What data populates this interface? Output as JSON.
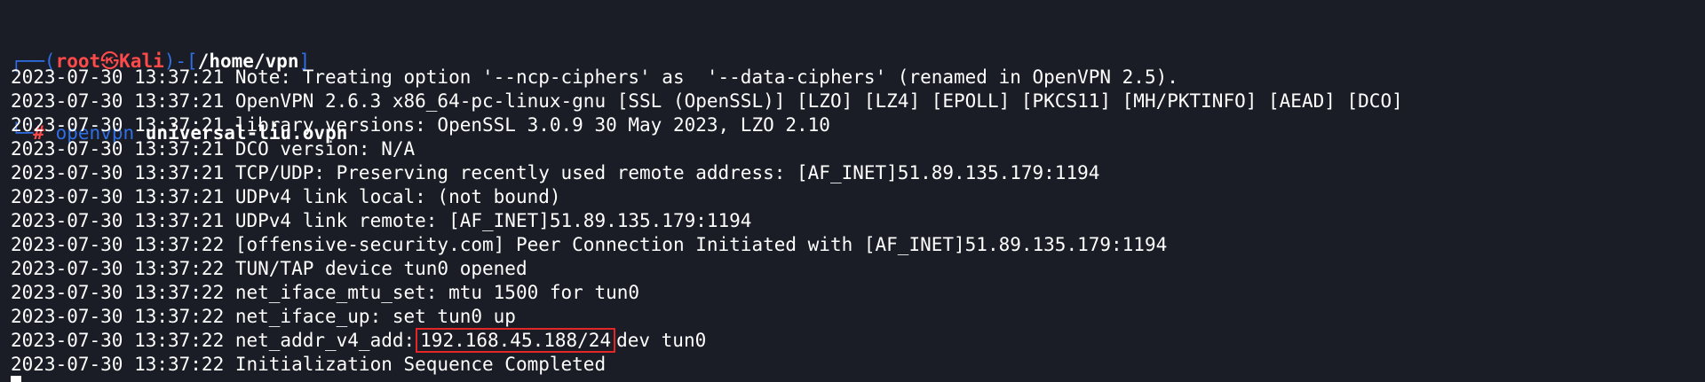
{
  "prompt": {
    "line1_open": "┌──(",
    "user": "root",
    "skull": "㉿",
    "host": "Kali",
    "line1_mid": ")-[",
    "path": "/home/vpn",
    "line1_close": "]",
    "line2_lead": "└─",
    "hash": "#",
    "command": "openvpn",
    "argument": "universal-liu.ovpn"
  },
  "output_lines": [
    "2023-07-30 13:37:21 Note: Treating option '--ncp-ciphers' as  '--data-ciphers' (renamed in OpenVPN 2.5).",
    "2023-07-30 13:37:21 OpenVPN 2.6.3 x86_64-pc-linux-gnu [SSL (OpenSSL)] [LZO] [LZ4] [EPOLL] [PKCS11] [MH/PKTINFO] [AEAD] [DCO]",
    "2023-07-30 13:37:21 library versions: OpenSSL 3.0.9 30 May 2023, LZO 2.10",
    "2023-07-30 13:37:21 DCO version: N/A",
    "2023-07-30 13:37:21 TCP/UDP: Preserving recently used remote address: [AF_INET]51.89.135.179:1194",
    "2023-07-30 13:37:21 UDPv4 link local: (not bound)",
    "2023-07-30 13:37:21 UDPv4 link remote: [AF_INET]51.89.135.179:1194",
    "2023-07-30 13:37:22 [offensive-security.com] Peer Connection Initiated with [AF_INET]51.89.135.179:1194",
    "2023-07-30 13:37:22 TUN/TAP device tun0 opened",
    "2023-07-30 13:37:22 net_iface_mtu_set: mtu 1500 for tun0",
    "2023-07-30 13:37:22 net_iface_up: set tun0 up"
  ],
  "addr_line": {
    "prefix": "2023-07-30 13:37:22 net_addr_v4_add:",
    "address": "192.168.45.188/24",
    "suffix": "dev tun0"
  },
  "final_line": "2023-07-30 13:37:22 Initialization Sequence Completed",
  "colors": {
    "background": "#1a1c26",
    "prompt_blue": "#2f6fe4",
    "prompt_red": "#ff4a4a",
    "highlight_box": "#e52626"
  }
}
